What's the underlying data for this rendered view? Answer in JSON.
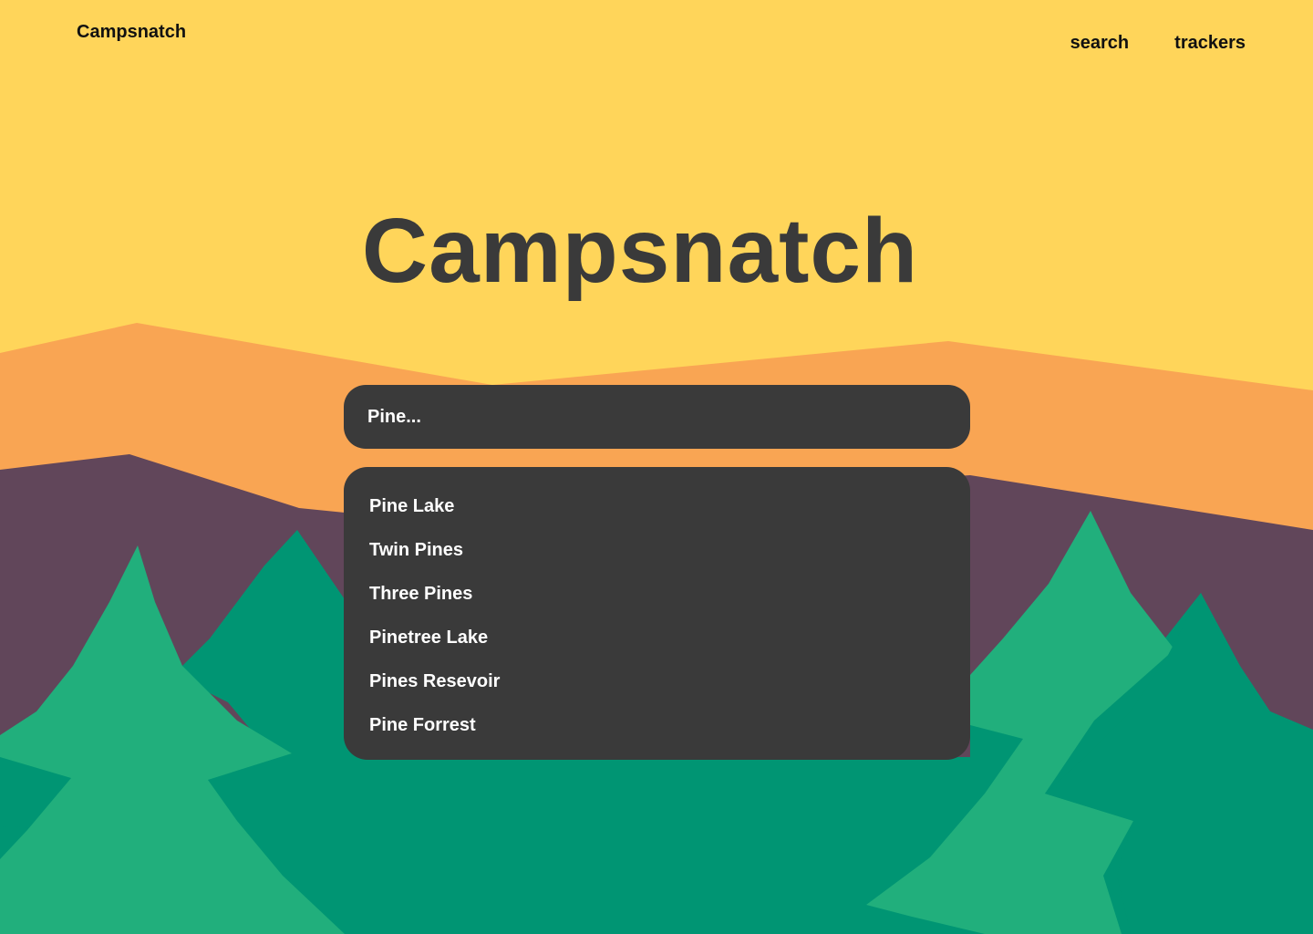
{
  "header": {
    "logo": "Campsnatch",
    "nav": {
      "search": "search",
      "trackers": "trackers"
    }
  },
  "hero": {
    "title": "Campsnatch"
  },
  "search": {
    "value": "Pine...",
    "results": [
      "Pine Lake",
      "Twin Pines",
      "Three Pines",
      "Pinetree Lake",
      "Pines Resevoir",
      "Pine Forrest"
    ]
  },
  "colors": {
    "sky": "#FFD55A",
    "far_mountain": "#F9A553",
    "near_mountain": "#61465A",
    "tree_dark": "#009573",
    "tree_light": "#21AF7C",
    "panel": "#3A3A3A",
    "panel_text": "#FFFFFF",
    "header_text": "#111111",
    "title_text": "#3A3A3A"
  }
}
